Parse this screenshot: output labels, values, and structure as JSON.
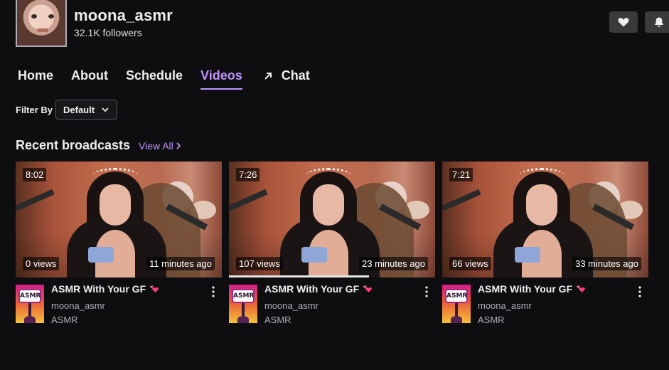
{
  "channel": {
    "name": "moona_asmr",
    "followers": "32.1K followers"
  },
  "nav": {
    "home": "Home",
    "about": "About",
    "schedule": "Schedule",
    "videos": "Videos",
    "chat": "Chat",
    "active": "Videos"
  },
  "filter": {
    "label": "Filter By",
    "value": "Default"
  },
  "section": {
    "title": "Recent broadcasts",
    "view_all": "View All"
  },
  "videos": [
    {
      "length": "8:02",
      "views": "0 views",
      "ago": "11 minutes ago",
      "title": "ASMR With Your GF",
      "channel": "moona_asmr",
      "category": "ASMR",
      "category_art_text": "ASMR",
      "watched_fraction": 0
    },
    {
      "length": "7:26",
      "views": "107 views",
      "ago": "23 minutes ago",
      "title": "ASMR With Your GF",
      "channel": "moona_asmr",
      "category": "ASMR",
      "category_art_text": "ASMR",
      "watched_fraction": 0.68
    },
    {
      "length": "7:21",
      "views": "66 views",
      "ago": "33 minutes ago",
      "title": "ASMR With Your GF",
      "channel": "moona_asmr",
      "category": "ASMR",
      "category_art_text": "ASMR",
      "watched_fraction": 0
    }
  ],
  "icons": {
    "follow": "heart-icon",
    "notify": "bell-icon",
    "chat_popout": "arrow-up-right-icon",
    "filter": "chevron-down-icon",
    "view_all": "chevron-right-icon",
    "more": "more-vertical-icon",
    "title_emoji": "two-hearts-icon"
  },
  "colors": {
    "background": "#0e0e10",
    "accent": "#bf94ff",
    "button": "#3a3a3d",
    "muted_text": "#adadb8",
    "heart_emoji": "#ff3d7f"
  }
}
